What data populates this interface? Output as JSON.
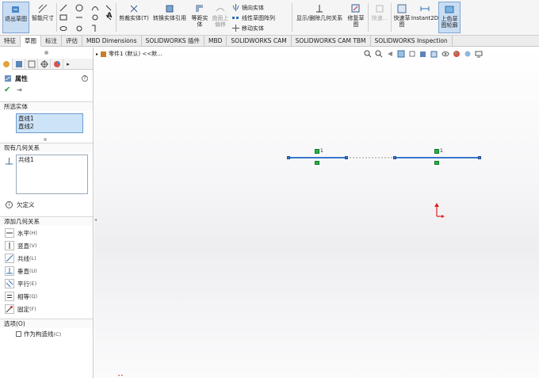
{
  "ribbon": {
    "exit_sketch": "退出草图",
    "smart_dim": "智能尺寸",
    "trim": "剪裁实体(T)",
    "convert": "转换实体引用",
    "offset": "等距实体",
    "surface_offset": "曲面上偏移",
    "mirror": "镜向实体",
    "linear_pattern": "线性草图阵列",
    "move": "移动实体",
    "display_relations": "显示/删除几何关系",
    "repair": "修复草图",
    "quick_snap": "快速...",
    "rapid_sketch": "快速草图",
    "instant2d": "Instant2D",
    "shaded": "上色草图轮廓"
  },
  "tabs": [
    "特征",
    "草图",
    "标注",
    "评估",
    "MBD Dimensions",
    "SOLIDWORKS 插件",
    "MBD",
    "SOLIDWORKS CAM",
    "SOLIDWORKS CAM TBM",
    "SOLIDWORKS Inspection"
  ],
  "panel": {
    "title": "属性",
    "selected_label": "所选实体",
    "selected_items": [
      "直线1",
      "直线2"
    ],
    "existing_label": "现有几何关系",
    "existing_items": [
      "共线1"
    ],
    "status": "欠定义",
    "add_label": "添加几何关系",
    "relations": [
      {
        "label": "水平",
        "key": "(H)"
      },
      {
        "label": "竖直",
        "key": "(V)"
      },
      {
        "label": "共线",
        "key": "(L)"
      },
      {
        "label": "垂直",
        "key": "(U)"
      },
      {
        "label": "平行",
        "key": "(E)"
      },
      {
        "label": "相等",
        "key": "(Q)"
      },
      {
        "label": "固定",
        "key": "(F)"
      }
    ],
    "options_label": "选项(O)",
    "construction": "作为构造线",
    "construction_key": "(C)"
  },
  "canvas": {
    "breadcrumb": "零件1 (默认) <<默..."
  },
  "sketch": {
    "line_color": "#3a78c9",
    "relation_color": "#29b14a",
    "badge_text": "1"
  }
}
